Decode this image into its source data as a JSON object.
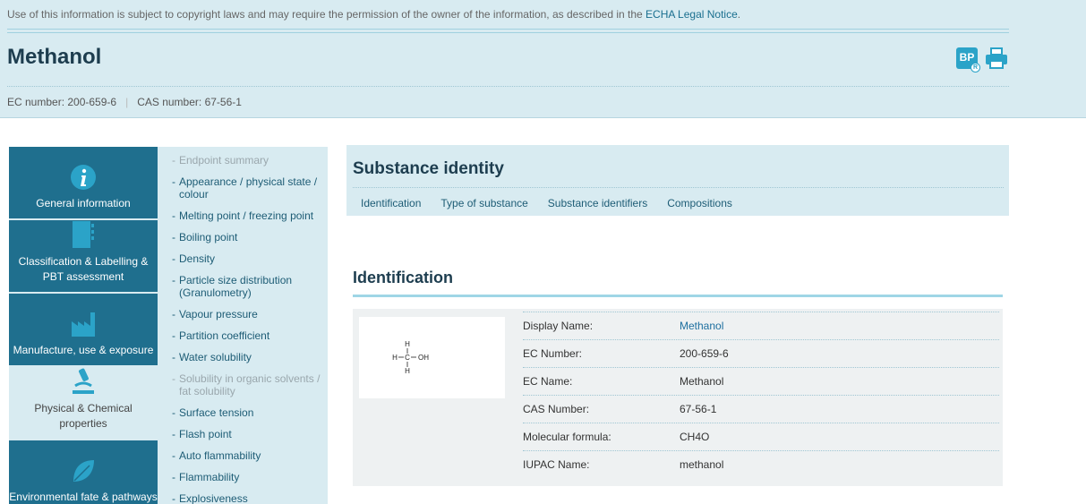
{
  "notice": {
    "text": "Use of this information is subject to copyright laws and may require the permission of the owner of the information, as described in the ",
    "link": "ECHA Legal Notice",
    "end": "."
  },
  "page_title": "Methanol",
  "header_icons": {
    "bp_label": "BP",
    "bp_badge": "R"
  },
  "identifiers": {
    "ec": "EC number: 200-659-6",
    "separator": "|",
    "cas": "CAS number: 67-56-1"
  },
  "nav": {
    "blocks": [
      {
        "label": "General information",
        "icon": "info-icon"
      },
      {
        "label": "Classification & Labelling & PBT assessment",
        "icon": "document-icon"
      },
      {
        "label": "Manufacture, use & exposure",
        "icon": "factory-icon"
      },
      {
        "label": "Physical & Chemical properties",
        "icon": "microscope-icon",
        "active": true
      },
      {
        "label": "Environmental fate & pathways",
        "icon": "leaf-icon"
      }
    ],
    "subitems": [
      {
        "label": "Endpoint summary",
        "muted": true
      },
      {
        "label": "Appearance / physical state / colour"
      },
      {
        "label": "Melting point / freezing point"
      },
      {
        "label": "Boiling point"
      },
      {
        "label": "Density"
      },
      {
        "label": "Particle size distribution (Granulometry)"
      },
      {
        "label": "Vapour pressure"
      },
      {
        "label": "Partition coefficient"
      },
      {
        "label": "Water solubility"
      },
      {
        "label": "Solubility in organic solvents / fat solubility",
        "muted": true
      },
      {
        "label": "Surface tension"
      },
      {
        "label": "Flash point"
      },
      {
        "label": "Auto flammability"
      },
      {
        "label": "Flammability"
      },
      {
        "label": "Explosiveness"
      }
    ]
  },
  "substance": {
    "title": "Substance identity",
    "tabs": [
      "Identification",
      "Type of substance",
      "Substance identifiers",
      "Compositions"
    ]
  },
  "identification": {
    "title": "Identification",
    "structure_labels": {
      "h_top": "H",
      "h_left": "H",
      "c": "C",
      "oh": "OH",
      "h_bottom": "H"
    },
    "rows": [
      {
        "label": "Display Name:",
        "value": "Methanol",
        "link": true
      },
      {
        "label": "EC Number:",
        "value": "200-659-6"
      },
      {
        "label": "EC Name:",
        "value": "Methanol"
      },
      {
        "label": "CAS Number:",
        "value": "67-56-1"
      },
      {
        "label": "Molecular formula:",
        "value": "CH4O"
      },
      {
        "label": "IUPAC Name:",
        "value": "methanol"
      }
    ]
  },
  "colors": {
    "band": "#d8ebf1",
    "nav_dark": "#1f6f8e",
    "accent": "#2ba3c8",
    "link": "#1a6f8f"
  }
}
